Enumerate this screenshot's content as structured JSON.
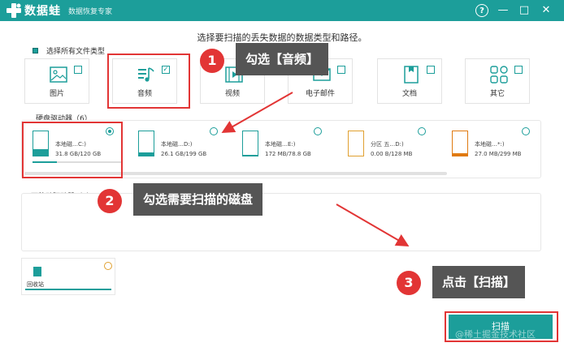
{
  "titlebar": {
    "app_name": "数据蛙",
    "app_sub": "数据恢复专家",
    "help": "?",
    "minimize": "—",
    "maximize": "□",
    "close": "✕"
  },
  "heading": "选择要扫描的丢失数据的数据类型和路径。",
  "select_all_label": "选择所有文件类型",
  "file_types": [
    {
      "label": "图片",
      "checked": false,
      "icon": "image-icon"
    },
    {
      "label": "音频",
      "checked": true,
      "icon": "audio-icon"
    },
    {
      "label": "视频",
      "checked": false,
      "icon": "video-icon"
    },
    {
      "label": "电子邮件",
      "checked": false,
      "icon": "email-icon"
    },
    {
      "label": "文档",
      "checked": false,
      "icon": "document-icon"
    },
    {
      "label": "其它",
      "checked": false,
      "icon": "other-icon"
    }
  ],
  "hard_drives_label": "硬盘驱动器（6）",
  "drives": [
    {
      "name": "本地磁…C:)",
      "size": "31.8 GB/120 GB",
      "selected": true,
      "used_fraction": 0.27,
      "color": "#1c9e9a"
    },
    {
      "name": "本地磁…D:)",
      "size": "26.1 GB/199 GB",
      "selected": false,
      "used_fraction": 0.13,
      "color": "#1c9e9a"
    },
    {
      "name": "本地磁…E:)",
      "size": "172 MB/78.8 GB",
      "selected": false,
      "used_fraction": 0.01,
      "color": "#1c9e9a"
    },
    {
      "name": "分区 五…D:)",
      "size": "0.00  B/128 MB",
      "selected": false,
      "used_fraction": 0.0,
      "color": "#e0a030"
    },
    {
      "name": "本地磁…*:)",
      "size": "27.0 MB/299 MB",
      "selected": false,
      "used_fraction": 0.09,
      "color": "#e07a10"
    }
  ],
  "removable_label": "可移动驱动器（0）",
  "recycle_label": "回收站",
  "scan_label": "扫描",
  "watermark": "@稀土掘金技术社区",
  "callouts": [
    {
      "step": "1",
      "text": "勾选【音频】"
    },
    {
      "step": "2",
      "text": "勾选需要扫描的磁盘"
    },
    {
      "step": "3",
      "text": "点击【扫描】"
    }
  ],
  "colors": {
    "accent": "#1c9e9a",
    "highlight": "#e23535",
    "callout_bg": "#555555"
  }
}
